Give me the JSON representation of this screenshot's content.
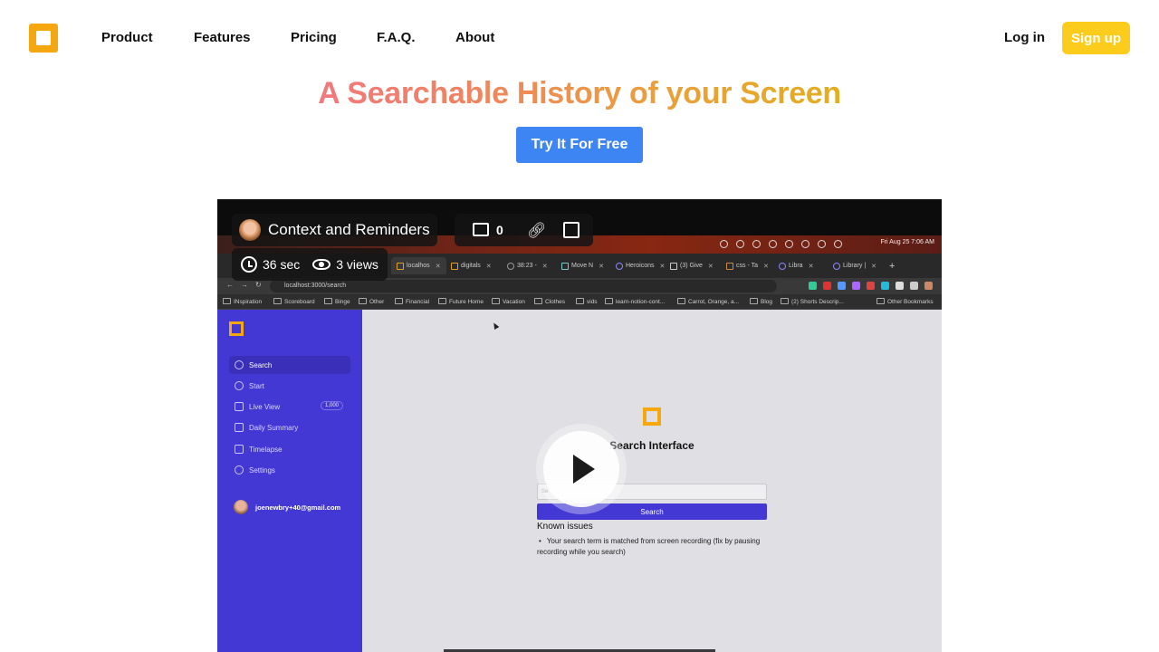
{
  "nav": {
    "links": [
      "Product",
      "Features",
      "Pricing",
      "F.A.Q.",
      "About"
    ],
    "login": "Log in",
    "signup": "Sign up"
  },
  "hero": {
    "title": "A Searchable History of your Screen",
    "cta": "Try It For Free"
  },
  "video": {
    "title": "Context and Reminders",
    "comments": "0",
    "duration": "36 sec",
    "views": "3 views",
    "menubar_clock": "Fri Aug 25  7:06 AM",
    "tabs": [
      "localhos",
      "digitals",
      "38:23 -",
      "Move N",
      "Heroicons",
      "(3) Give",
      "css - Ta",
      "Libra",
      "Library |"
    ],
    "address": "localhost:3000/search",
    "bookmarks": [
      "INspiration",
      "Scoreboard",
      "Binge",
      "Other",
      "Financial",
      "Future Home",
      "Vacation",
      "Clothes",
      "vids",
      "learn-notion-cont...",
      "Carrot, Orange, a...",
      "Blog",
      "(2) Shorts Descrip...",
      "Other Bookmarks"
    ],
    "app": {
      "sidebar": [
        {
          "label": "Search"
        },
        {
          "label": "Start"
        },
        {
          "label": "Live View",
          "badge": "1,000"
        },
        {
          "label": "Daily Summary"
        },
        {
          "label": "Timelapse"
        },
        {
          "label": "Settings"
        }
      ],
      "user_email": "joenewbry+40@gmail.com",
      "search_title": "Search Interface",
      "search_placeholder": "Se",
      "search_button": "Search",
      "known_issues_title": "Known issues",
      "known_issue_1": "Your search term is matched from screen recording (fix by pausing recording while you search)"
    }
  },
  "colors": {
    "accent": "#f5a70f",
    "signup": "#fccc1d",
    "cta": "#3d85f2",
    "app_sidebar": "#4338d4"
  }
}
